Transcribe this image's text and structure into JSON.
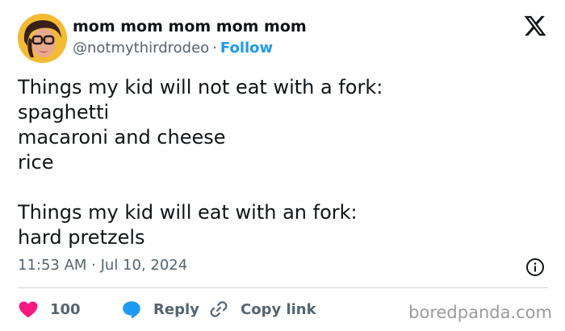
{
  "author": {
    "display_name": "mom mom mom mom mom",
    "handle": "@notmythirdrodeo",
    "separator": "·",
    "follow_label": "Follow"
  },
  "tweet": {
    "lines": [
      "Things my kid will not eat with a fork:",
      "spaghetti",
      "macaroni and cheese",
      "rice",
      "",
      "Things my kid will eat with an fork:",
      "hard pretzels"
    ],
    "timestamp": "11:53 AM · Jul 10, 2024"
  },
  "actions": {
    "like_count": "100",
    "reply_label": "Reply",
    "copy_link_label": "Copy link"
  },
  "watermark": "boredpanda.com",
  "colors": {
    "accent": "#1d9bf0",
    "heart": "#f91880",
    "text": "#0f1419",
    "secondary": "#536471",
    "divider": "#cfd9de"
  },
  "icons": [
    "avatar",
    "x-logo-icon",
    "info-icon",
    "heart-icon",
    "reply-bubble-icon",
    "link-icon"
  ]
}
